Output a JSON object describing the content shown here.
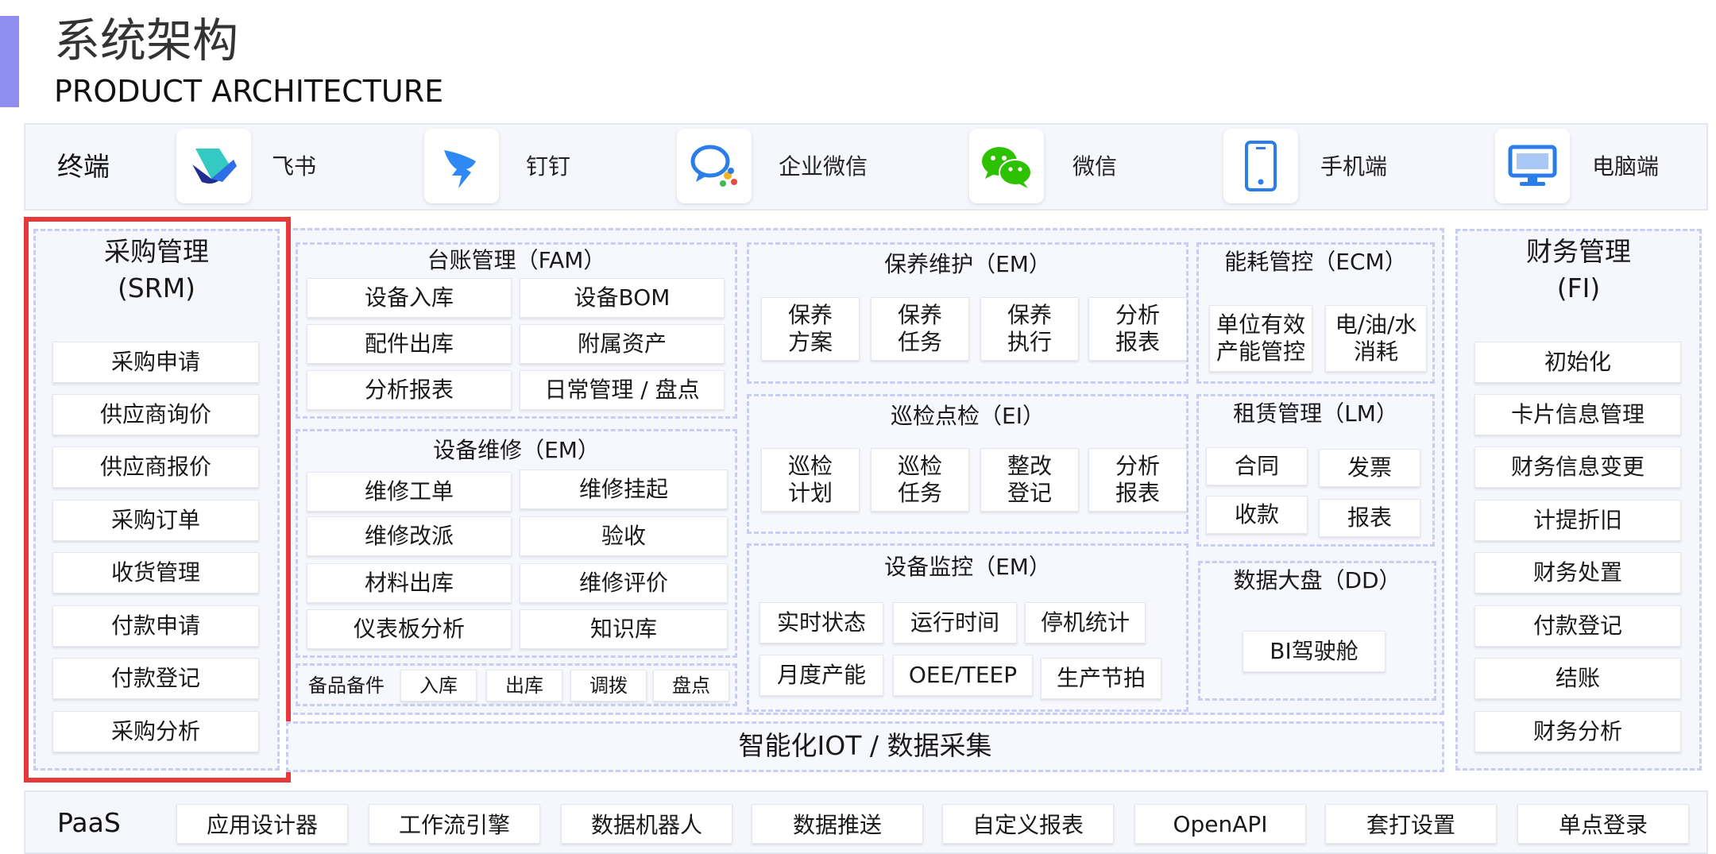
{
  "header": {
    "title_cn": "系统架构",
    "title_en": "PRODUCT ARCHITECTURE"
  },
  "terminal": {
    "label": "终端",
    "items": [
      {
        "icon": "feishu-icon",
        "label": "飞书"
      },
      {
        "icon": "dingtalk-icon",
        "label": "钉钉"
      },
      {
        "icon": "wecom-icon",
        "label": "企业微信"
      },
      {
        "icon": "wechat-icon",
        "label": "微信"
      },
      {
        "icon": "mobile-phone-icon",
        "label": "手机端"
      },
      {
        "icon": "desktop-monitor-icon",
        "label": "电脑端"
      }
    ]
  },
  "srm": {
    "title": "采购管理",
    "subtitle": "(SRM)",
    "items": [
      "采购申请",
      "供应商询价",
      "供应商报价",
      "采购订单",
      "收货管理",
      "付款申请",
      "付款登记",
      "采购分析"
    ]
  },
  "fam": {
    "title": "台账管理（FAM）",
    "items": [
      "设备入库",
      "设备BOM",
      "配件出库",
      "附属资产",
      "分析报表",
      "日常管理 / 盘点"
    ]
  },
  "repair": {
    "title": "设备维修（EM）",
    "items": [
      "维修工单",
      "维修挂起",
      "维修改派",
      "验收",
      "材料出库",
      "维修评价",
      "仪表板分析",
      "知识库"
    ]
  },
  "spare": {
    "title": "备品备件",
    "items": [
      "入库",
      "出库",
      "调拨",
      "盘点"
    ]
  },
  "maintenance": {
    "title": "保养维护（EM）",
    "items": [
      [
        "保养",
        "方案"
      ],
      [
        "保养",
        "任务"
      ],
      [
        "保养",
        "执行"
      ],
      [
        "分析",
        "报表"
      ]
    ]
  },
  "inspection": {
    "title": "巡检点检（EI）",
    "items": [
      [
        "巡检",
        "计划"
      ],
      [
        "巡检",
        "任务"
      ],
      [
        "整改",
        "登记"
      ],
      [
        "分析",
        "报表"
      ]
    ]
  },
  "monitor": {
    "title": "设备监控（EM）",
    "items": [
      "实时状态",
      "运行时间",
      "停机统计",
      "月度产能",
      "OEE/TEEP",
      "生产节拍"
    ]
  },
  "energy": {
    "title": "能耗管控（ECM）",
    "items": [
      [
        "单位有效",
        "产能管控"
      ],
      [
        "电/油/水",
        "消耗"
      ]
    ]
  },
  "lease": {
    "title": "租赁管理（LM）",
    "items": [
      "合同",
      "发票",
      "收款",
      "报表"
    ]
  },
  "dashboard": {
    "title": "数据大盘（DD）",
    "items": [
      "BI驾驶舱"
    ]
  },
  "iot": {
    "label": "智能化IOT / 数据采集"
  },
  "fi": {
    "title": "财务管理",
    "subtitle": "(FI)",
    "items": [
      "初始化",
      "卡片信息管理",
      "财务信息变更",
      "计提折旧",
      "财务处置",
      "付款登记",
      "结账",
      "财务分析"
    ]
  },
  "paas": {
    "label": "PaaS",
    "items": [
      "应用设计器",
      "工作流引擎",
      "数据机器人",
      "数据推送",
      "自定义报表",
      "OpenAPI",
      "套打设置",
      "单点登录"
    ]
  },
  "colors": {
    "accent": "#8d8ef0",
    "highlight": "#e8393a",
    "dashed_border": "#c9cdf2",
    "band_bg": "#f5f7fc"
  }
}
